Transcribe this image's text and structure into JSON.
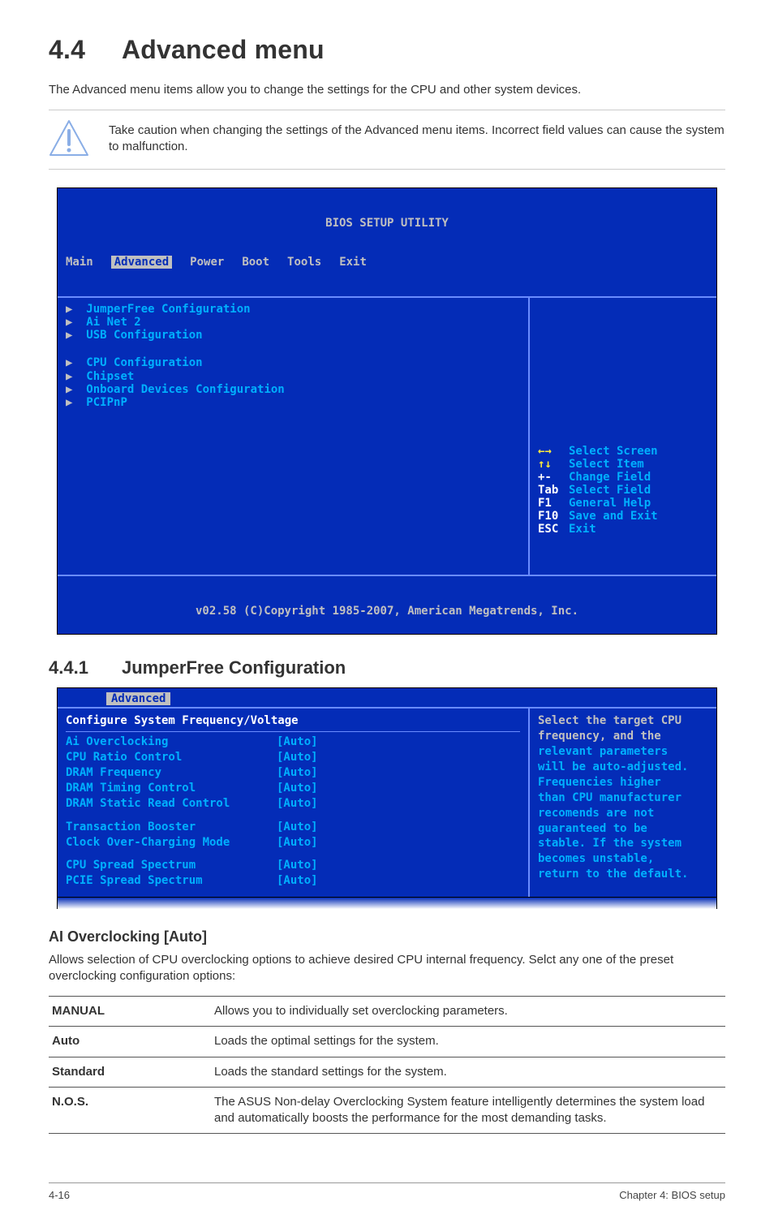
{
  "heading": {
    "number": "4.4",
    "title": "Advanced menu"
  },
  "intro": "The Advanced menu items allow you to change the settings for the CPU and other system devices.",
  "caution": "Take caution when changing the settings of the Advanced menu items. Incorrect field values can cause the system to malfunction.",
  "bios1": {
    "title": "BIOS SETUP UTILITY",
    "tabs": [
      "Main",
      "Advanced",
      "Power",
      "Boot",
      "Tools",
      "Exit"
    ],
    "active_tab": "Advanced",
    "group1": [
      "JumperFree Configuration",
      "Ai Net 2",
      "USB Configuration"
    ],
    "group2": [
      "CPU Configuration",
      "Chipset",
      "Onboard Devices Configuration",
      "PCIPnP"
    ],
    "help": [
      {
        "key": "←→",
        "label": "Select Screen",
        "arrow": true
      },
      {
        "key": "↑↓",
        "label": "Select Item",
        "arrow": true
      },
      {
        "key": "+-",
        "label": "Change Field"
      },
      {
        "key": "Tab",
        "label": "Select Field"
      },
      {
        "key": "F1",
        "label": "General Help"
      },
      {
        "key": "F10",
        "label": "Save and Exit"
      },
      {
        "key": "ESC",
        "label": "Exit"
      }
    ],
    "footer": "v02.58 (C)Copyright 1985-2007, American Megatrends, Inc."
  },
  "subsection": {
    "number": "4.4.1",
    "title": "JumperFree Configuration"
  },
  "bios2": {
    "tab_label": "Advanced",
    "header": "Configure System Frequency/Voltage",
    "rows1": [
      {
        "label": "Ai Overclocking",
        "val": "[Auto]"
      },
      {
        "label": "CPU Ratio Control",
        "val": "[Auto]"
      },
      {
        "label": "DRAM Frequency",
        "val": "[Auto]"
      },
      {
        "label": "DRAM Timing Control",
        "val": "[Auto]"
      },
      {
        "label": "DRAM Static Read Control",
        "val": "[Auto]"
      }
    ],
    "rows2": [
      {
        "label": "Transaction Booster",
        "val": "[Auto]"
      },
      {
        "label": "Clock Over-Charging Mode",
        "val": "[Auto]"
      }
    ],
    "rows3": [
      {
        "label": "CPU Spread Spectrum",
        "val": "[Auto]"
      },
      {
        "label": "PCIE Spread Spectrum",
        "val": "[Auto]"
      }
    ],
    "desc_lines": [
      {
        "text": "Select the target CPU",
        "color": "#c0c0c0"
      },
      {
        "text": "frequency, and the",
        "color": "#c0c0c0"
      },
      {
        "text": "relevant parameters",
        "color": "#00b0ff"
      },
      {
        "text": "will be auto-adjusted.",
        "color": "#00b0ff"
      },
      {
        "text": "Frequencies higher",
        "color": "#00b0ff"
      },
      {
        "text": "than CPU manufacturer",
        "color": "#00b0ff"
      },
      {
        "text": "recomends are not",
        "color": "#00b0ff"
      },
      {
        "text": "guaranteed to be",
        "color": "#00b0ff"
      },
      {
        "text": "stable. If the system",
        "color": "#00b0ff"
      },
      {
        "text": "becomes unstable,",
        "color": "#00b0ff"
      },
      {
        "text": "return to the default.",
        "color": "#00b0ff"
      }
    ]
  },
  "option_head": "AI Overclocking [Auto]",
  "option_body": "Allows selection of CPU overclocking options to achieve desired CPU internal frequency. Selct any one of the preset overclocking configuration options:",
  "opts": [
    {
      "k": "MANUAL",
      "v": "Allows you to individually set overclocking parameters."
    },
    {
      "k": "Auto",
      "v": "Loads the optimal settings for the system."
    },
    {
      "k": "Standard",
      "v": "Loads the standard settings for the system."
    },
    {
      "k": "N.O.S.",
      "v": "The ASUS Non-delay Overclocking System feature intelligently determines the system load and automatically boosts the performance for the most demanding tasks."
    }
  ],
  "footer": {
    "left": "4-16",
    "right": "Chapter 4: BIOS setup"
  }
}
